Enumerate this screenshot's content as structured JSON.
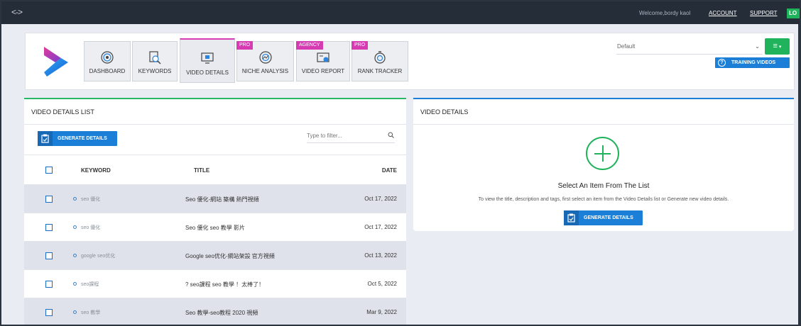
{
  "topbar": {
    "expand_icon": "expand-arrows-icon",
    "welcome": "Welcome,bordy kaol",
    "account": "ACCOUNT",
    "support": "SUPPORT",
    "logout": "LO"
  },
  "nav": {
    "tabs": [
      {
        "label": "DASHBOARD",
        "icon": "target-icon",
        "badge": ""
      },
      {
        "label": "KEYWORDS",
        "icon": "keyword-search-icon",
        "badge": ""
      },
      {
        "label": "VIDEO DETAILS",
        "icon": "video-screen-icon",
        "badge": ""
      },
      {
        "label": "NICHE ANALYSIS",
        "icon": "analysis-icon",
        "badge": "PRO"
      },
      {
        "label": "VIDEO REPORT",
        "icon": "report-icon",
        "badge": "AGENCY"
      },
      {
        "label": "RANK TRACKER",
        "icon": "stopwatch-icon",
        "badge": "PRO"
      }
    ],
    "active_tab": "VIDEO DETAILS",
    "select_value": "Default",
    "training_label": "TRAINING VIDEOS"
  },
  "list": {
    "title": "VIDEO DETAILS LIST",
    "generate_label": "GENERATE DETAILS",
    "filter_placeholder": "Type to filter...",
    "columns": {
      "keyword": "KEYWORD",
      "title": "TITLE",
      "date": "DATE"
    },
    "rows": [
      {
        "keyword": "seo 優化",
        "title": "Seo 優化-網站 築構 熱門視頻",
        "date": "Oct 17, 2022"
      },
      {
        "keyword": "seo 優化",
        "title": "Seo 優化 seo 教學 影片",
        "date": "Oct 17, 2022"
      },
      {
        "keyword": "google seo优化",
        "title": "Google seo优化-網站架設 官方視頻",
        "date": "Oct 13, 2022"
      },
      {
        "keyword": "seo課程",
        "title": "? seo課程 seo 教學 ！太棒了！",
        "date": "Oct 5, 2022"
      },
      {
        "keyword": "seo 教學",
        "title": "Seo 教學-seo教程 2020 視頻",
        "date": "Mar 9, 2022"
      }
    ]
  },
  "details": {
    "title": "VIDEO DETAILS",
    "select_title": "Select An Item From The List",
    "select_desc": "To view the title, description and tags, first select an item from the Video Details list or Generate new video details.",
    "generate_label": "GENERATE DETAILS"
  },
  "colors": {
    "accent_green": "#1fb35c",
    "accent_blue": "#1b7fd8",
    "badge_pink": "#d63bb2"
  }
}
